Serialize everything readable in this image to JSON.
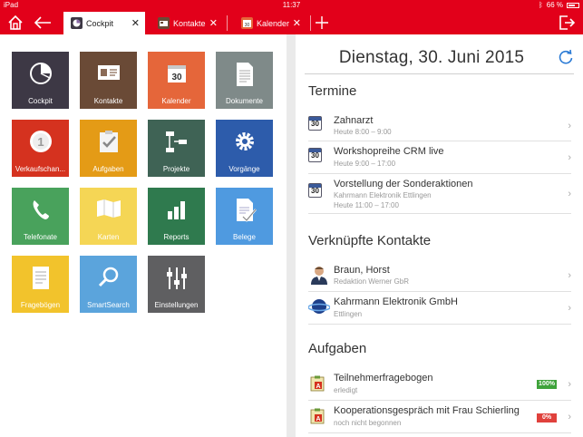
{
  "statusbar": {
    "carrier": "iPad",
    "time": "11:37",
    "battery": "66 %",
    "battery_level": 0.66
  },
  "tabs": [
    {
      "label": "Cockpit",
      "active": true
    },
    {
      "label": "Kontakte",
      "active": false
    },
    {
      "label": "Kalender",
      "active": false
    }
  ],
  "colors": {
    "brand": "#e2001a"
  },
  "tiles": [
    {
      "label": "Cockpit",
      "color": "#3d3845",
      "icon": "pie-chart-icon"
    },
    {
      "label": "Kontakte",
      "color": "#6a4a36",
      "icon": "contacts-icon"
    },
    {
      "label": "Kalender",
      "color": "#e5663a",
      "icon": "calendar-icon"
    },
    {
      "label": "Dokumente",
      "color": "#7f8a89",
      "icon": "document-icon"
    },
    {
      "label": "Verkaufschan...",
      "color": "#d5321f",
      "icon": "number-one-icon"
    },
    {
      "label": "Aufgaben",
      "color": "#e49b16",
      "icon": "clipboard-check-icon"
    },
    {
      "label": "Projekte",
      "color": "#3f6355",
      "icon": "flowchart-icon"
    },
    {
      "label": "Vorgänge",
      "color": "#2d5cab",
      "icon": "gear-icon"
    },
    {
      "label": "Telefonate",
      "color": "#49a25c",
      "icon": "phone-icon"
    },
    {
      "label": "Karten",
      "color": "#f5d655",
      "icon": "map-icon"
    },
    {
      "label": "Reports",
      "color": "#2f7a4e",
      "icon": "bar-chart-icon"
    },
    {
      "label": "Belege",
      "color": "#4f9ae0",
      "icon": "receipt-check-icon"
    },
    {
      "label": "Fragebögen",
      "color": "#f2c32c",
      "icon": "form-icon"
    },
    {
      "label": "SmartSearch",
      "color": "#5ba4dc",
      "icon": "magnifier-icon"
    },
    {
      "label": "Einstellungen",
      "color": "#5f5f61",
      "icon": "sliders-icon"
    }
  ],
  "right": {
    "date": "Dienstag, 30. Juni 2015",
    "termine_title": "Termine",
    "calendar_day": "30",
    "termine": [
      {
        "title": "Zahnarzt",
        "sub": "Heute 8:00 – 9:00"
      },
      {
        "title": "Workshopreihe CRM live",
        "sub": "Heute 9:00 – 17:00"
      },
      {
        "title": "Vorstellung der Sonderaktionen",
        "sub": "Kahrmann Elektronik Ettlingen",
        "sub2": "Heute 11:00 – 17:00"
      }
    ],
    "kontakte_title": "Verknüpfte Kontakte",
    "kontakte": [
      {
        "title": "Braun, Horst",
        "sub": "Redaktion Werner GbR"
      },
      {
        "title": "Kahrmann Elektronik GmbH",
        "sub": "Ettlingen"
      }
    ],
    "aufgaben_title": "Aufgaben",
    "aufgaben": [
      {
        "title": "Teilnehmerfragebogen",
        "sub": "erledigt",
        "progress": "100%",
        "progress_color": "#3ea33a"
      },
      {
        "title": "Kooperationsgespräch mit Frau Schierling",
        "sub": "noch nicht begonnen",
        "progress": "0%",
        "progress_color": "#e0413c"
      }
    ]
  }
}
